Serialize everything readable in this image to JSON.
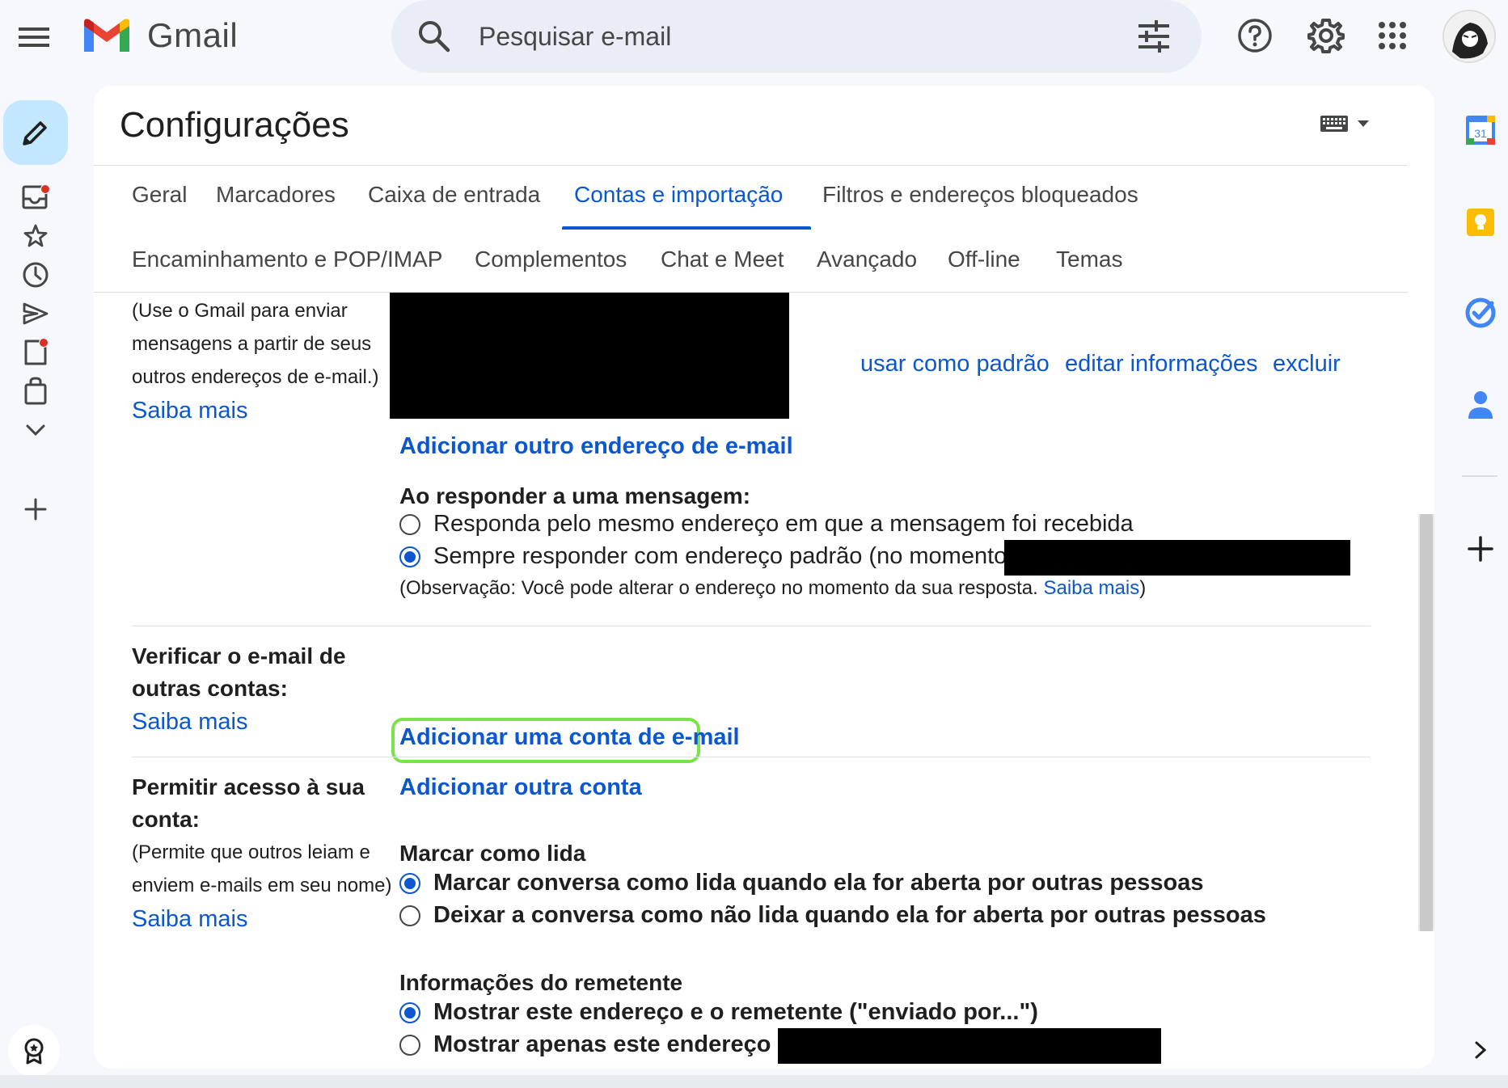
{
  "app": {
    "name": "Gmail",
    "menu_icon": "hamburger-menu-icon",
    "logo_icon": "gmail-m-logo"
  },
  "search": {
    "placeholder": "Pesquisar e-mail",
    "icon": "search-icon",
    "options_icon": "tune-icon"
  },
  "top_actions": [
    {
      "name": "help-icon"
    },
    {
      "name": "settings-gear-icon"
    },
    {
      "name": "apps-grid-icon"
    },
    {
      "name": "account-avatar"
    }
  ],
  "left_rail": {
    "compose_icon": "pencil-icon",
    "items": [
      {
        "icon": "inbox-icon",
        "badge": true
      },
      {
        "icon": "star-icon",
        "badge": false
      },
      {
        "icon": "clock-icon",
        "badge": false
      },
      {
        "icon": "send-icon",
        "badge": false
      },
      {
        "icon": "draft-icon",
        "badge": true
      },
      {
        "icon": "purchases-icon",
        "badge": false
      },
      {
        "icon": "chevron-down-icon",
        "badge": false
      },
      {
        "icon": "plus-icon",
        "badge": false
      }
    ],
    "bottom_icon": "award-icon"
  },
  "page": {
    "title": "Configurações",
    "keyboard_icon": "keyboard-icon"
  },
  "tabs_row1": [
    "Geral",
    "Marcadores",
    "Caixa de entrada",
    "Contas e importação",
    "Filtros e endereços bloqueados"
  ],
  "tabs_row2": [
    "Encaminhamento e POP/IMAP",
    "Complementos",
    "Chat e Meet",
    "Avançado",
    "Off-line",
    "Temas"
  ],
  "active_tab": "Contas e importação",
  "send_as": {
    "desc_1": "(Use o Gmail para enviar",
    "desc_2": "mensagens a partir de seus",
    "desc_3": "outros endereços de e-mail.)",
    "learn_more": "Saiba mais",
    "actions": [
      "usar como padrão",
      "editar informações",
      "excluir"
    ],
    "add_address": "Adicionar outro endereço de e-mail",
    "reply_heading": "Ao responder a uma mensagem:",
    "reply_options": [
      {
        "label": "Responda pelo mesmo endereço em que a mensagem foi recebida",
        "checked": false
      },
      {
        "label": "Sempre responder com endereço padrão (no momento",
        "checked": true
      }
    ],
    "note_prefix": "(Observação: Você pode alterar o endereço no momento da sua resposta. ",
    "note_link": "Saiba mais",
    "note_suffix": ")"
  },
  "check_mail": {
    "label_1": "Verificar o e-mail de",
    "label_2": "outras contas:",
    "learn_more": "Saiba mais",
    "add_account": "Adicionar uma conta de e-mail"
  },
  "grant_access": {
    "label_1": "Permitir acesso à sua",
    "label_2": "conta:",
    "desc_1": "(Permite que outros leiam e",
    "desc_2": "enviem e-mails em seu nome)",
    "learn_more": "Saiba mais",
    "add_other": "Adicionar outra conta",
    "mark_read_heading": "Marcar como lida",
    "mark_read_options": [
      {
        "label": "Marcar conversa como lida quando ela for aberta por outras pessoas",
        "checked": true
      },
      {
        "label": "Deixar a conversa como não lida quando ela for aberta por outras pessoas",
        "checked": false
      }
    ],
    "sender_heading": "Informações do remetente",
    "sender_options": [
      {
        "label": "Mostrar este endereço e o remetente (\"enviado por...\")",
        "checked": true
      },
      {
        "label": "Mostrar apenas este endereço (",
        "checked": false
      }
    ]
  },
  "side_apps": [
    {
      "icon": "calendar-icon",
      "text": "31"
    },
    {
      "icon": "keep-icon"
    },
    {
      "icon": "tasks-icon"
    },
    {
      "icon": "contacts-icon"
    },
    {
      "icon": "add-app-icon"
    },
    {
      "icon": "chevron-right-icon"
    }
  ],
  "colors": {
    "accent": "#0b57d0",
    "compose_bg": "#c2e7ff",
    "search_bg": "#e9eef6",
    "highlight": "#7be34a",
    "badge": "#d93025"
  }
}
